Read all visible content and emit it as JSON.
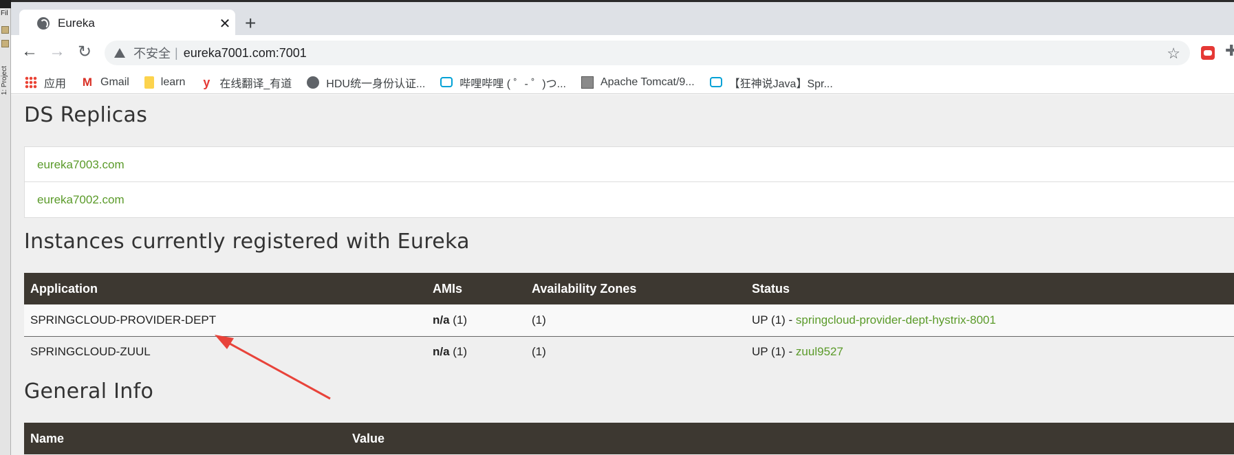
{
  "ide": {
    "menu_text": "Fil",
    "vertical_label": "1: Project"
  },
  "browser": {
    "tab_title": "Eureka",
    "new_tab_symbol": "+",
    "address": {
      "security_label": "不安全",
      "url": "eureka7001.com:7001"
    },
    "bookmarks": [
      {
        "label": "应用",
        "icon": "apps-icon"
      },
      {
        "label": "Gmail",
        "icon": "gmail-icon"
      },
      {
        "label": "learn",
        "icon": "folder-icon"
      },
      {
        "label": "在线翻译_有道",
        "icon": "youdao-icon"
      },
      {
        "label": "HDU统一身份认证...",
        "icon": "globe-icon"
      },
      {
        "label": "哔哩哔哩 ( ゜- ゜)つ...",
        "icon": "bilibili-icon"
      },
      {
        "label": "Apache Tomcat/9...",
        "icon": "tomcat-icon"
      },
      {
        "label": "【狂神说Java】Spr...",
        "icon": "bilibili-icon"
      }
    ]
  },
  "page": {
    "ds_replicas": {
      "title": "DS Replicas",
      "items": [
        "eureka7003.com",
        "eureka7002.com"
      ]
    },
    "instances": {
      "title": "Instances currently registered with Eureka",
      "headers": [
        "Application",
        "AMIs",
        "Availability Zones",
        "Status"
      ],
      "rows": [
        {
          "application": "SPRINGCLOUD-PROVIDER-DEPT",
          "ami": "n/a",
          "ami_count": "(1)",
          "zones": "(1)",
          "status": "UP (1) - ",
          "instance_link": "springcloud-provider-dept-hystrix-8001"
        },
        {
          "application": "SPRINGCLOUD-ZUUL",
          "ami": "n/a",
          "ami_count": "(1)",
          "zones": "(1)",
          "status": "UP (1) - ",
          "instance_link": "zuul9527"
        }
      ]
    },
    "general_info": {
      "title": "General Info",
      "headers": [
        "Name",
        "Value"
      ]
    }
  },
  "annotation": {
    "color": "#e8433a"
  }
}
